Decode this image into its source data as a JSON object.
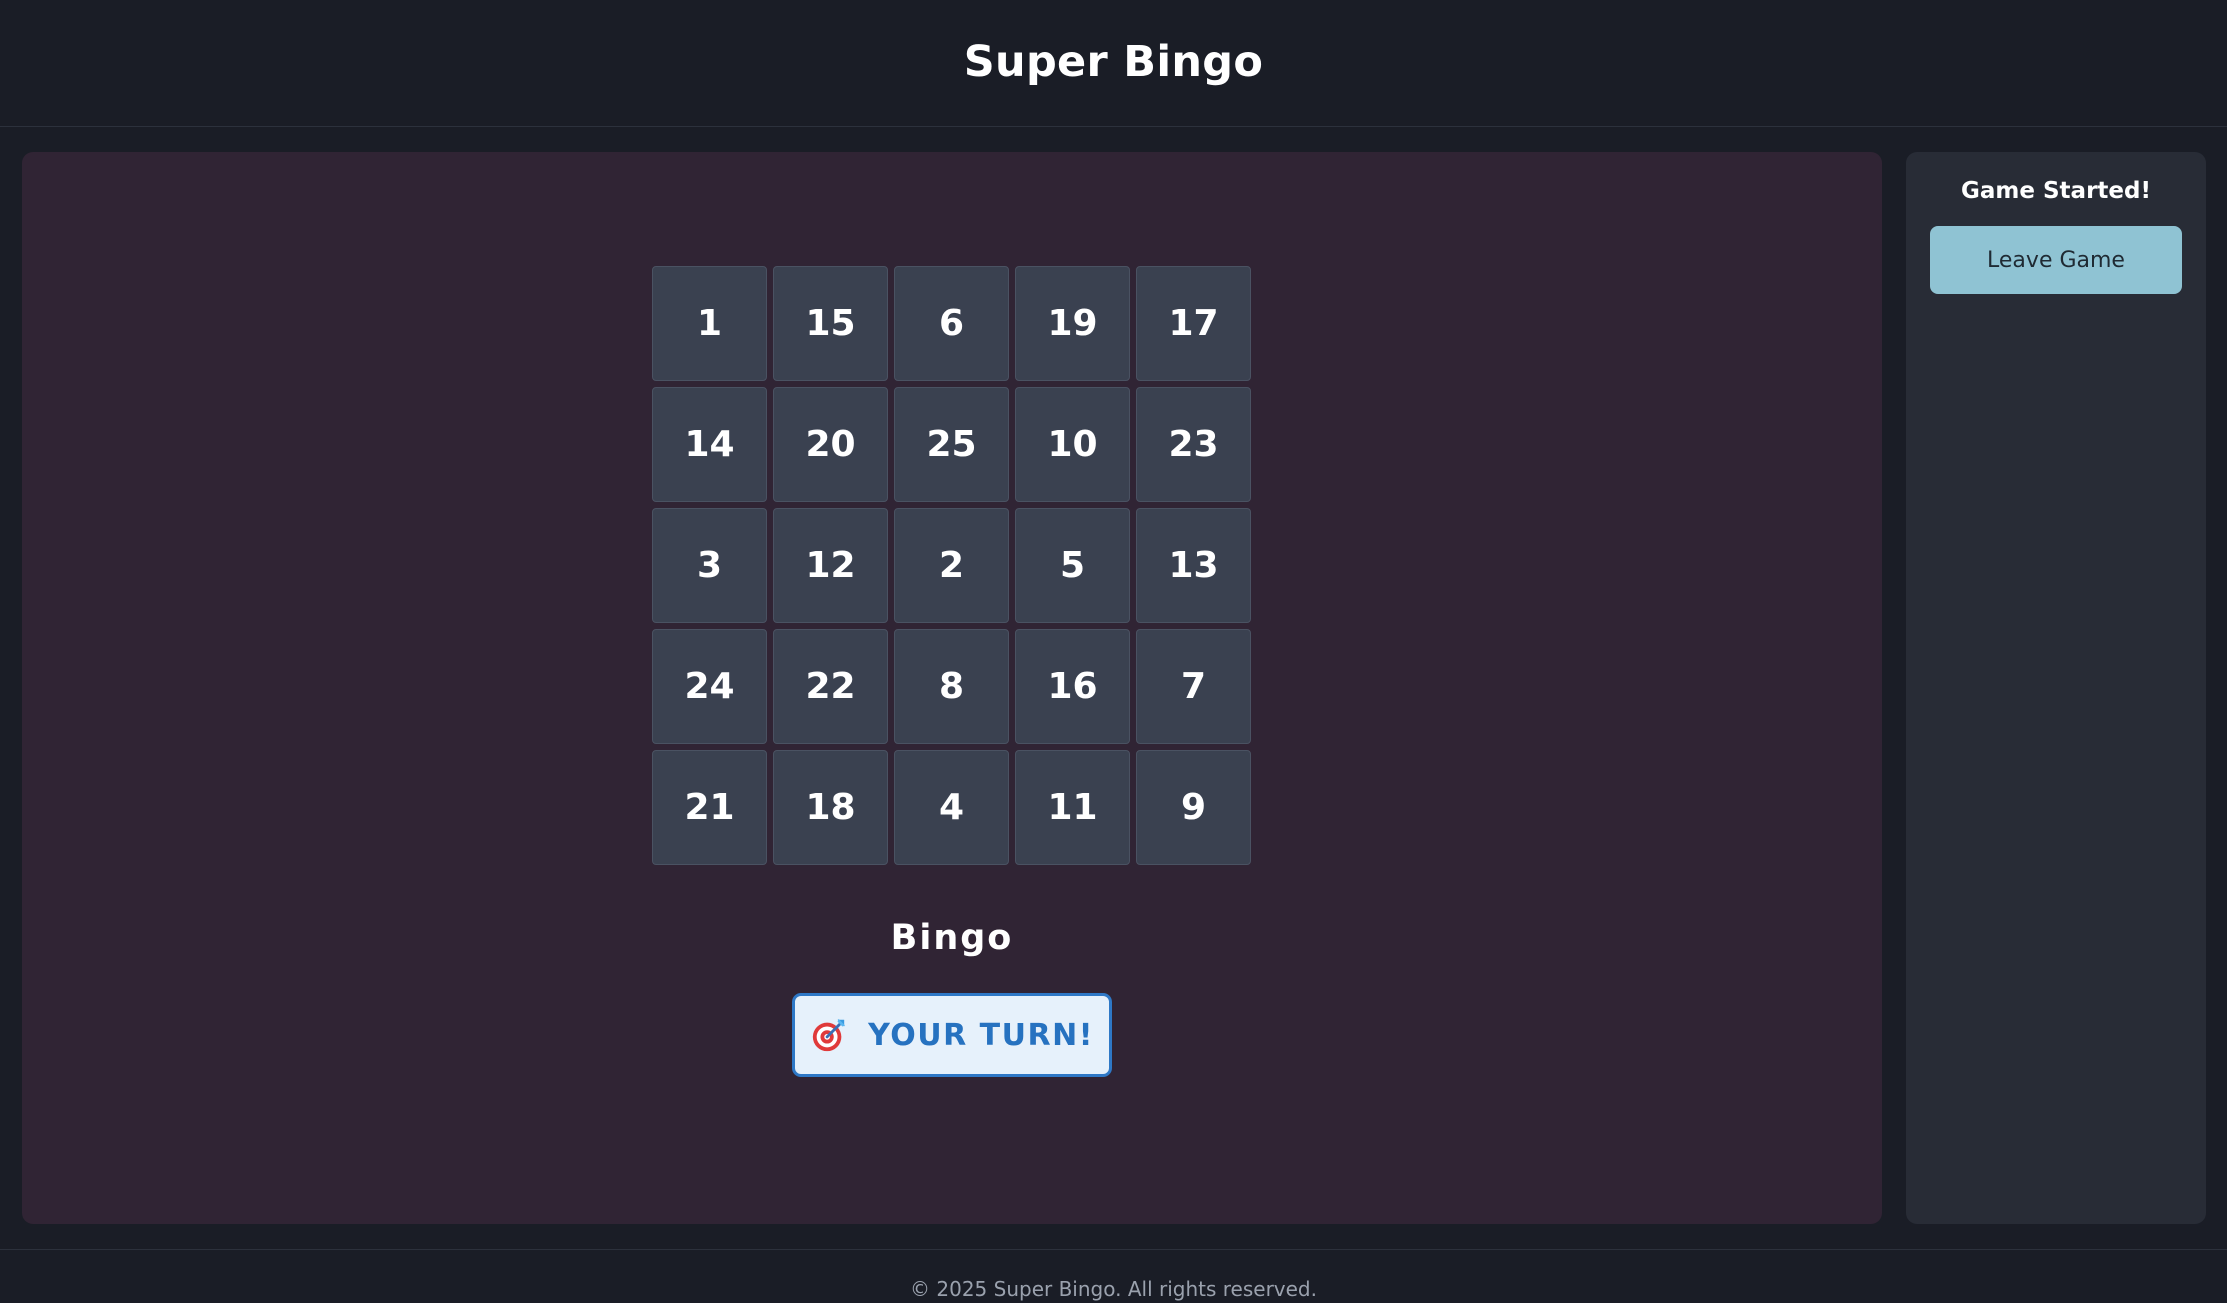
{
  "header": {
    "title": "Super Bingo"
  },
  "board": {
    "rows": [
      [
        "1",
        "15",
        "6",
        "19",
        "17"
      ],
      [
        "14",
        "20",
        "25",
        "10",
        "23"
      ],
      [
        "3",
        "12",
        "2",
        "5",
        "13"
      ],
      [
        "24",
        "22",
        "8",
        "16",
        "7"
      ],
      [
        "21",
        "18",
        "4",
        "11",
        "9"
      ]
    ]
  },
  "bingo_label": "Bingo",
  "turn": {
    "icon": "target-icon",
    "label": "YOUR TURN!"
  },
  "sidebar": {
    "status": "Game Started!",
    "leave_label": "Leave Game"
  },
  "footer": {
    "text": "© 2025 Super Bingo. All rights reserved."
  },
  "colors": {
    "page_bg": "#1a1d26",
    "main_panel_bg": "#302434",
    "side_panel_bg": "#282c36",
    "cell_bg": "#3a4150",
    "leave_button_bg": "#8fc3d3",
    "turn_badge_bg": "#e6f1fb",
    "turn_badge_accent": "#2e78c6"
  }
}
